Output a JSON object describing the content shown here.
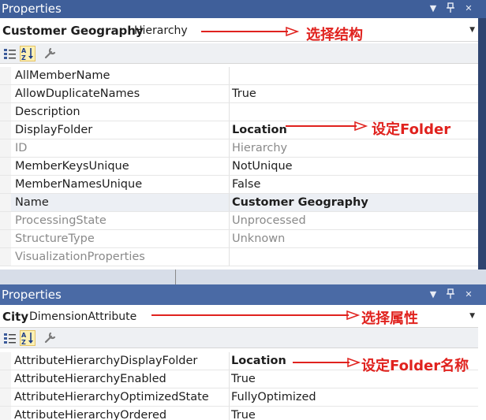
{
  "panels": [
    {
      "title": "Properties",
      "object_name": "Customer Geography",
      "object_type": "Hierarchy",
      "annotation_select": "选择结构",
      "annotation_folder": "设定Folder",
      "rows": [
        {
          "name": "AllMemberName",
          "value": ""
        },
        {
          "name": "AllowDuplicateNames",
          "value": "True"
        },
        {
          "name": "Description",
          "value": ""
        },
        {
          "name": "DisplayFolder",
          "value": "Location"
        },
        {
          "name": "ID",
          "value": "Hierarchy"
        },
        {
          "name": "MemberKeysUnique",
          "value": "NotUnique"
        },
        {
          "name": "MemberNamesUnique",
          "value": "False"
        },
        {
          "name": "Name",
          "value": "Customer Geography"
        },
        {
          "name": "ProcessingState",
          "value": "Unprocessed"
        },
        {
          "name": "StructureType",
          "value": "Unknown"
        },
        {
          "name": "VisualizationProperties",
          "value": ""
        }
      ]
    },
    {
      "title": "Properties",
      "object_name": "City",
      "object_type": "DimensionAttribute",
      "annotation_select": "选择属性",
      "annotation_folder": "设定Folder名称",
      "rows": [
        {
          "name": "AttributeHierarchyDisplayFolder",
          "value": "Location"
        },
        {
          "name": "AttributeHierarchyEnabled",
          "value": "True"
        },
        {
          "name": "AttributeHierarchyOptimizedState",
          "value": "FullyOptimized"
        },
        {
          "name": "AttributeHierarchyOrdered",
          "value": "True"
        }
      ]
    }
  ],
  "colors": {
    "titlebar": "#3f5f9a",
    "annotation": "#e0221e",
    "disabled_text": "#8a8a8a"
  }
}
